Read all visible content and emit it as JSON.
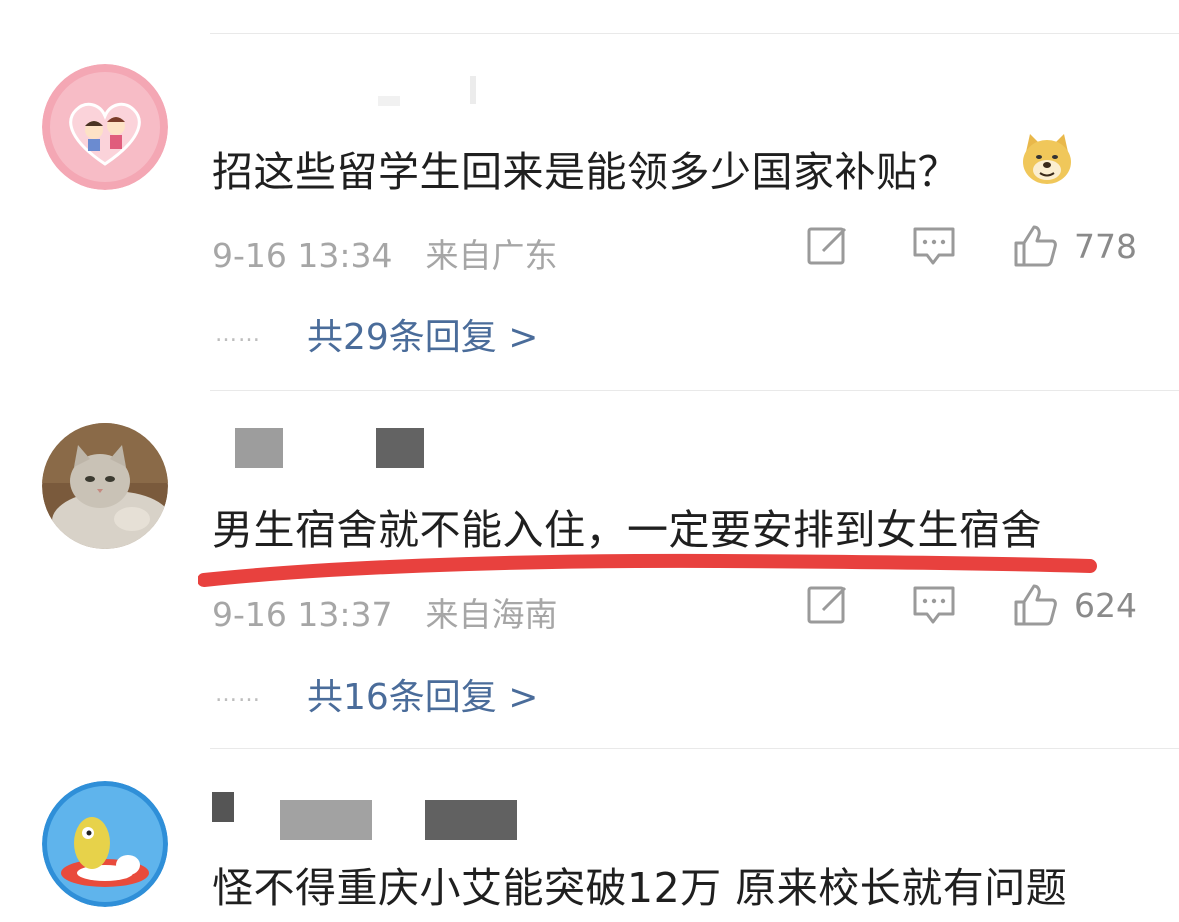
{
  "comments": [
    {
      "username": "",
      "text": "招这些留学生回来是能领多少国家补贴？",
      "emoji": "doge-emoji",
      "time": "9-16 13:34",
      "location": "来自广东",
      "likes": "778",
      "replies": "共29条回复 >"
    },
    {
      "username": "",
      "text": "男生宿舍就不能入住，一定要安排到女生宿舍",
      "time": "9-16 13:37",
      "location": "来自海南",
      "likes": "624",
      "replies": "共16条回复 >",
      "underline_color": "#e8413e"
    },
    {
      "username": "",
      "text": "怪不得重庆小艾能突破12万 原来校长就有问题"
    }
  ],
  "dots": "……",
  "icons": [
    "edit-icon",
    "comment-icon",
    "like-icon"
  ],
  "colors": {
    "link": "#4a6c9a",
    "meta": "#a6a6a6",
    "underline": "#e8413e"
  }
}
